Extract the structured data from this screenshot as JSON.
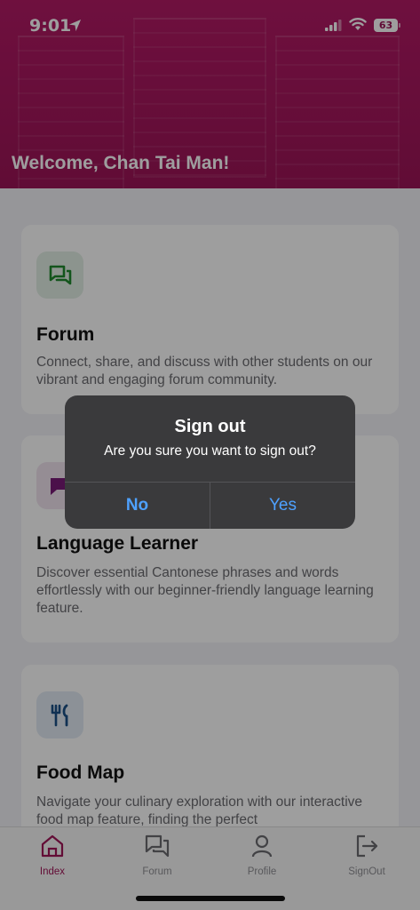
{
  "status_bar": {
    "time": "9:01",
    "battery": "63"
  },
  "header": {
    "welcome": "Welcome, Chan Tai Man!"
  },
  "cards": [
    {
      "title": "Forum",
      "description": "Connect, share, and discuss with other students on our vibrant and engaging forum community.",
      "icon": "chat-bubbles-icon",
      "color": "#1f8a2e"
    },
    {
      "title": "Language Learner",
      "description": "Discover essential Cantonese phrases and words effortlessly with our beginner-friendly language learning feature.",
      "icon": "speech-bubble-icon",
      "color": "#7a1a78"
    },
    {
      "title": "Food Map",
      "description": "Navigate your culinary exploration with our interactive food map feature, finding the perfect",
      "icon": "fork-knife-icon",
      "color": "#1b4f86"
    }
  ],
  "tabs": [
    {
      "label": "Index",
      "icon": "home-icon",
      "active": true
    },
    {
      "label": "Forum",
      "icon": "chat-icon",
      "active": false
    },
    {
      "label": "Profile",
      "icon": "person-icon",
      "active": false
    },
    {
      "label": "SignOut",
      "icon": "signout-icon",
      "active": false
    }
  ],
  "alert": {
    "title": "Sign out",
    "message": "Are you sure you want to sign out?",
    "no_label": "No",
    "yes_label": "Yes"
  },
  "colors": {
    "brand": "#a11558",
    "alert_bg": "#3a3a3c",
    "alert_button": "#4ea1ff"
  }
}
